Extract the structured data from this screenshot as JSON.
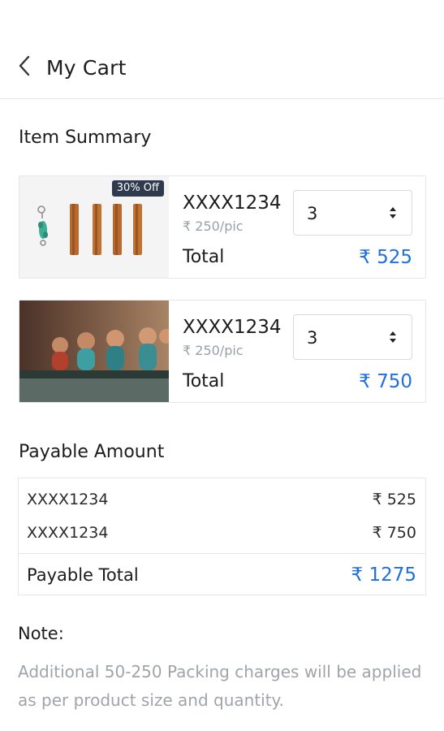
{
  "header": {
    "title": "My Cart",
    "back_icon": "chevron-left-icon"
  },
  "item_summary": {
    "title": "Item Summary",
    "items": [
      {
        "sku": "XXXX1234",
        "unit_price": "₹ 250/pic",
        "quantity": "3",
        "total_label": "Total",
        "total_value": "₹ 525",
        "badge": "30% Off",
        "image": "cinnamon-sticks-keychain"
      },
      {
        "sku": "XXXX1234",
        "unit_price": "₹ 250/pic",
        "quantity": "3",
        "total_label": "Total",
        "total_value": "₹ 750",
        "image": "monk-figurines"
      }
    ]
  },
  "payable": {
    "title": "Payable Amount",
    "rows": [
      {
        "sku": "XXXX1234",
        "amount": "₹ 525"
      },
      {
        "sku": "XXXX1234",
        "amount": "₹ 750"
      }
    ],
    "total_label": "Payable Total",
    "total_value": "₹ 1275"
  },
  "note": {
    "title": "Note:",
    "text": "Additional 50-250 Packing charges will be applied as per product size and quantity."
  },
  "colors": {
    "accent": "#1f6fe0",
    "muted": "#a0a4a9",
    "badge": "#2f3a4c",
    "border": "#e3e6ea"
  }
}
